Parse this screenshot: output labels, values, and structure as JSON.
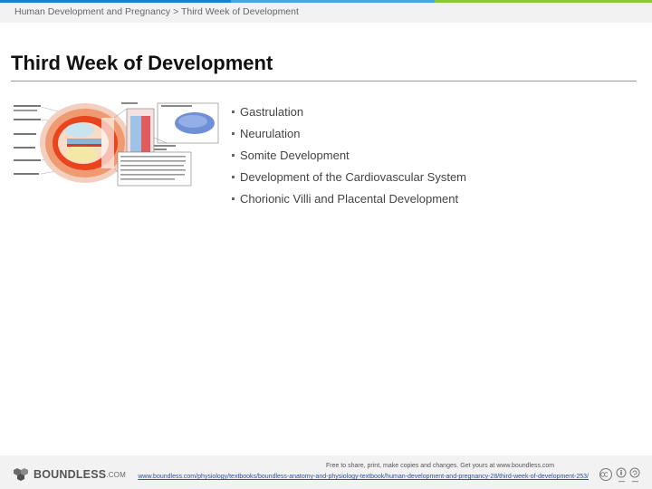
{
  "breadcrumb": "Human Development and Pregnancy > Third Week of Development",
  "title": "Third Week of Development",
  "topics": [
    "Gastrulation",
    "Neurulation",
    "Somite Development",
    "Development of the Cardiovascular System",
    "Chorionic Villi and Placental Development"
  ],
  "footer": {
    "logo_main": "BOUNDLESS",
    "logo_suffix": ".COM",
    "credit": "Free to share, print, make copies and changes. Get yours at www.boundless.com",
    "source_url": "www.boundless.com/physiology/textbooks/boundless-anatomy-and-physiology-textbook/human-development-and-pregnancy-28/third-week-of-development-253/"
  },
  "colors": {
    "stripe_blue": "#1f7fc4",
    "stripe_green": "#8cc63f",
    "link": "#2a4fa0"
  }
}
